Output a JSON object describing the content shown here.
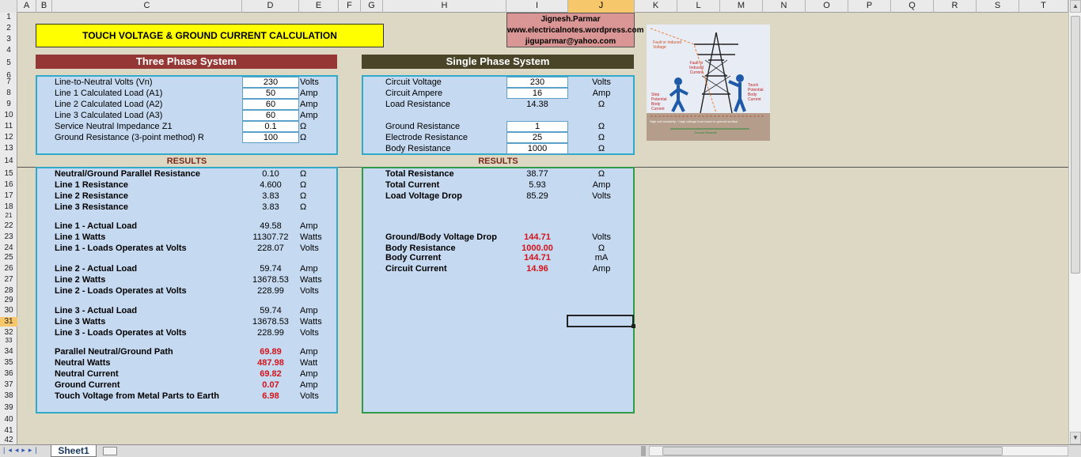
{
  "columns": [
    "A",
    "B",
    "C",
    "D",
    "E",
    "F",
    "G",
    "H",
    "I",
    "J",
    "K",
    "L",
    "M",
    "N",
    "O",
    "P",
    "Q",
    "R",
    "S",
    "T"
  ],
  "selected_column": "J",
  "rows": [
    "1",
    "2",
    "3",
    "4",
    "5",
    "6",
    "7",
    "8",
    "9",
    "10",
    "11",
    "12",
    "13",
    "14",
    "15",
    "16",
    "17",
    "18",
    "21",
    "22",
    "23",
    "24",
    "25",
    "26",
    "27",
    "28",
    "29",
    "30",
    "31",
    "32",
    "33",
    "34",
    "35",
    "36",
    "37",
    "38",
    "39",
    "40",
    "41",
    "42"
  ],
  "selected_row": "31",
  "title": "TOUCH VOLTAGE & GROUND CURRENT CALCULATION",
  "author": {
    "name": "Jignesh.Parmar",
    "site": "www.electricalnotes.wordpress.com",
    "email": "jiguparmar@yahoo.com"
  },
  "three_phase": {
    "heading": "Three Phase System",
    "inputs": [
      {
        "label": "Line-to-Neutral Volts (Vn)",
        "value": "230",
        "unit": "Volts"
      },
      {
        "label": "Line 1 Calculated Load (A1)",
        "value": "50",
        "unit": "Amp"
      },
      {
        "label": "Line 2 Calculated Load (A2)",
        "value": "60",
        "unit": "Amp"
      },
      {
        "label": "Line 3 Calculated Load (A3)",
        "value": "60",
        "unit": "Amp"
      },
      {
        "label": "Service Neutral Impedance Z1",
        "value": "0.1",
        "unit": "Ω"
      },
      {
        "label": "Ground Resistance (3-point method) R",
        "value": "100",
        "unit": "Ω"
      }
    ],
    "results_label": "RESULTS",
    "results": [
      {
        "label": "Neutral/Ground Parallel Resistance",
        "value": "0.10",
        "unit": "Ω"
      },
      {
        "label": "Line 1 Resistance",
        "value": "4.600",
        "unit": "Ω"
      },
      {
        "label": "Line 2 Resistance",
        "value": "3.83",
        "unit": "Ω"
      },
      {
        "label": "Line 3 Resistance",
        "value": "3.83",
        "unit": "Ω"
      },
      {
        "label": "Line 1 - Actual Load",
        "value": "49.58",
        "unit": "Amp"
      },
      {
        "label": "Line 1 Watts",
        "value": "11307.72",
        "unit": "Watts"
      },
      {
        "label": "Line 1 - Loads Operates at Volts",
        "value": "228.07",
        "unit": "Volts"
      },
      {
        "label": "Line 2 - Actual Load",
        "value": "59.74",
        "unit": "Amp"
      },
      {
        "label": "Line 2 Watts",
        "value": "13678.53",
        "unit": "Watts"
      },
      {
        "label": "Line 2 - Loads Operates at Volts",
        "value": "228.99",
        "unit": "Volts"
      },
      {
        "label": "Line 3 - Actual Load",
        "value": "59.74",
        "unit": "Amp"
      },
      {
        "label": "Line 3 Watts",
        "value": "13678.53",
        "unit": "Watts"
      },
      {
        "label": "Line 3 - Loads Operates at Volts",
        "value": "228.99",
        "unit": "Volts"
      },
      {
        "label": "Parallel Neutral/Ground Path",
        "value": "69.89",
        "unit": "Amp"
      },
      {
        "label": "Neutral Watts",
        "value": "487.98",
        "unit": "Watt"
      },
      {
        "label": "Neutral Current",
        "value": "69.82",
        "unit": "Amp"
      },
      {
        "label": "Ground Current",
        "value": "0.07",
        "unit": "Amp"
      },
      {
        "label": "Touch Voltage from Metal Parts to Earth",
        "value": "6.98",
        "unit": "Volts"
      }
    ]
  },
  "single_phase": {
    "heading": "Single Phase System",
    "inputs": [
      {
        "label": "Circuit Voltage",
        "value": "230",
        "unit": "Volts"
      },
      {
        "label": "Circuit Ampere",
        "value": "16",
        "unit": "Amp"
      },
      {
        "label": "Load Resistance",
        "value": "14.38",
        "unit": "Ω"
      },
      {
        "label": "Ground Resistance",
        "value": "1",
        "unit": "Ω"
      },
      {
        "label": "Electrode Resistance",
        "value": "25",
        "unit": "Ω"
      },
      {
        "label": "Body Resistance",
        "value": "1000",
        "unit": "Ω"
      }
    ],
    "results_label": "RESULTS",
    "results": [
      {
        "label": "Total Resistance",
        "value": "38.77",
        "unit": "Ω"
      },
      {
        "label": "Total Current",
        "value": "5.93",
        "unit": "Amp"
      },
      {
        "label": "Load Voltage Drop",
        "value": "85.29",
        "unit": "Volts"
      },
      {
        "label": "Ground/Body Voltage Drop",
        "value": "144.71",
        "unit": "Volts"
      },
      {
        "label": "Body Resistance",
        "value": "1000.00",
        "unit": "Ω"
      },
      {
        "label": "Body Current",
        "value": "144.71",
        "unit": "mA"
      },
      {
        "label": "Circuit Current",
        "value": "14.96",
        "unit": "Amp"
      }
    ]
  },
  "picture": {
    "labels": [
      "Fault or Induced Voltage",
      "Fault or Induced Current",
      "Step Potential Body Current",
      "Touch Potential Body Current",
      "High soil resistivity + high voltage from tower to ground surface",
      "Ground Network"
    ]
  },
  "sheet_tab": "Sheet1",
  "colors": {
    "three_phase_bar": "#953734",
    "single_phase_bar": "#4a4529",
    "title_fill": "#ffff00",
    "author_fill": "#d99694",
    "panel": "#c5d9f1",
    "panel_border_3ph": "#31a9c9",
    "panel_border_1ph": "#2e9a4a",
    "result_red": "#d4131a",
    "results_label": "#7a2a1a"
  }
}
